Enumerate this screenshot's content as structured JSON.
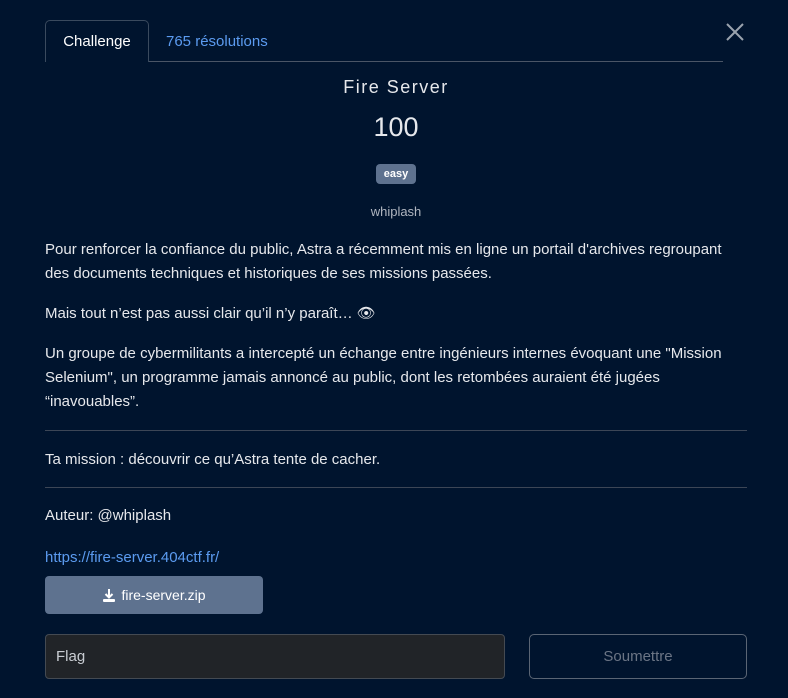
{
  "tabs": [
    {
      "label": "Challenge"
    },
    {
      "label": "765 résolutions"
    }
  ],
  "challenge": {
    "name": "Fire Server",
    "value": "100",
    "difficulty": "easy",
    "author_tag": "whiplash"
  },
  "description": {
    "p1": "Pour renforcer la confiance du public, Astra a récemment mis en ligne un portail d'archives regroupant des documents techniques et historiques de ses missions passées.",
    "p2": "Mais tout n’est pas aussi clair qu’il n’y paraît… 👁",
    "p3": "Un groupe de cybermilitants a intercepté un échange entre ingénieurs internes évoquant une \"Mission Selenium\", un programme jamais annoncé au public, dont les retombées auraient été jugées “inavouables”.",
    "mission": "Ta mission : découvrir ce qu’Astra tente de cacher.",
    "author": "Auteur: @whiplash",
    "link": "https://fire-server.404ctf.fr/"
  },
  "file": {
    "label": "fire-server.zip"
  },
  "form": {
    "placeholder": "Flag",
    "submit_label": "Soumettre"
  }
}
